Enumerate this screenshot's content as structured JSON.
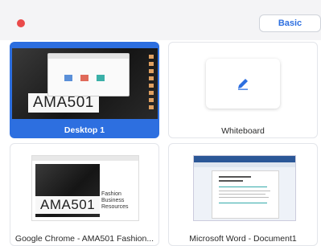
{
  "header": {
    "basic_label": "Basic"
  },
  "tiles": [
    {
      "label": "Desktop 1",
      "thumb_text": "AMA501",
      "selected": true
    },
    {
      "label": "Whiteboard",
      "selected": false
    },
    {
      "label": "Google Chrome - AMA501 Fashion...",
      "thumb_text": "AMA501",
      "thumb_subtitle": "Fashion Business Resources",
      "selected": false
    },
    {
      "label": "Microsoft Word - Document1",
      "selected": false
    }
  ],
  "colors": {
    "accent": "#2d6fe0",
    "close": "#ea4a4a"
  },
  "icons": {
    "whiteboard": "pencil-icon"
  }
}
